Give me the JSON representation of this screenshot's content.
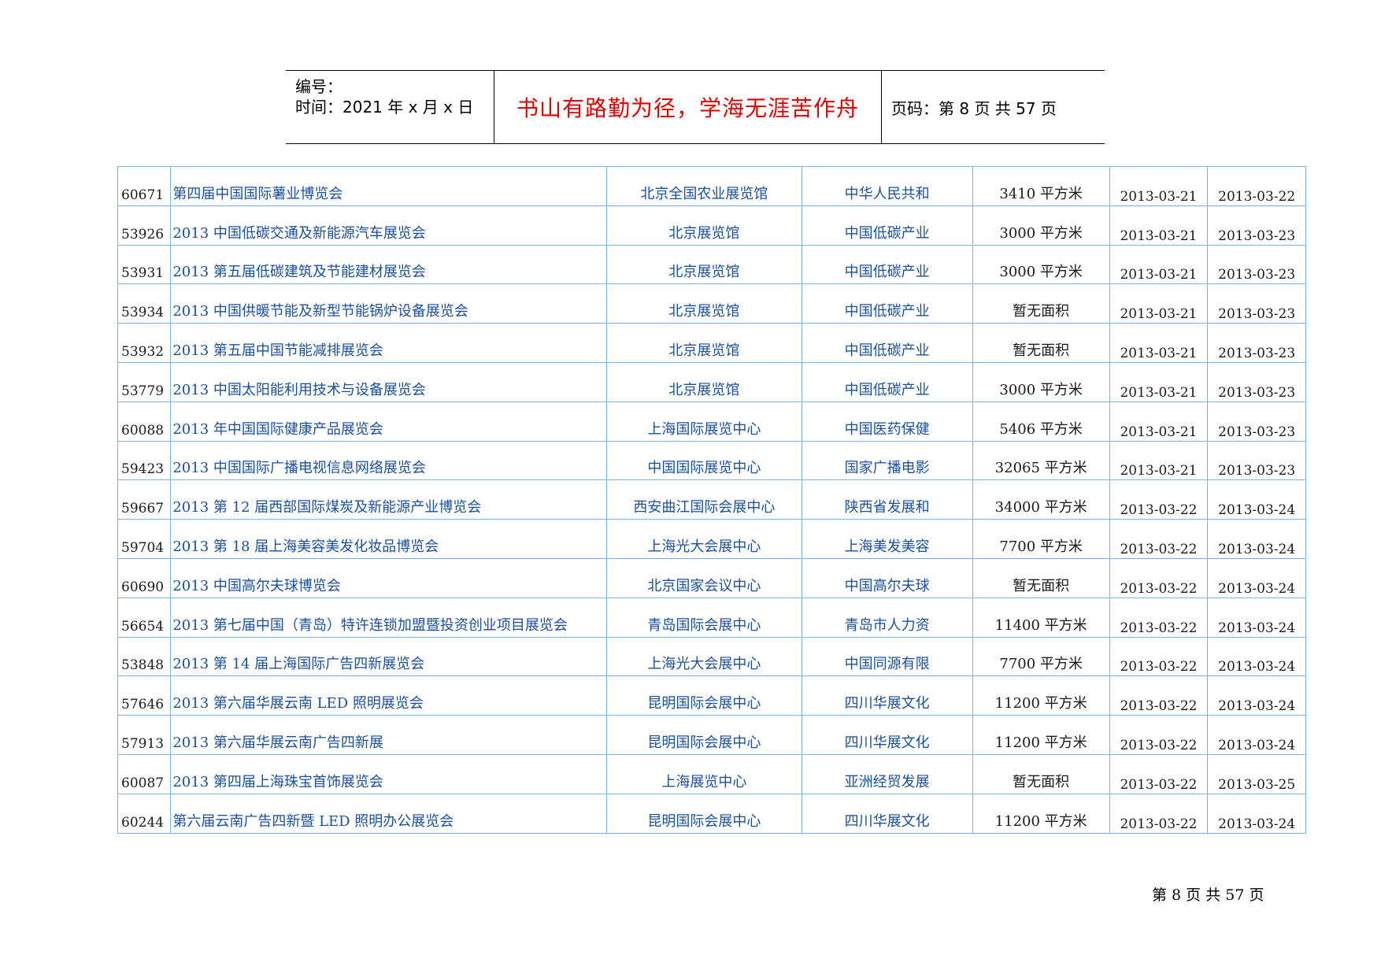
{
  "header": {
    "number_label": "编号：",
    "time_label": "时间：2021 年 x 月 x 日",
    "motto": "书山有路勤为径，学海无涯苦作舟",
    "page_label": "页码：第 8 页  共 57 页"
  },
  "rows": [
    {
      "id": "60671",
      "name": "第四届中国国际薯业博览会",
      "venue": "北京全国农业展览馆",
      "organizer": "中华人民共和",
      "area": "3410 平方米",
      "start": "2013-03-21",
      "end": "2013-03-22"
    },
    {
      "id": "53926",
      "name": "2013 中国低碳交通及新能源汽车展览会",
      "venue": "北京展览馆",
      "organizer": "中国低碳产业",
      "area": "3000 平方米",
      "start": "2013-03-21",
      "end": "2013-03-23"
    },
    {
      "id": "53931",
      "name": "2013 第五届低碳建筑及节能建材展览会",
      "venue": "北京展览馆",
      "organizer": "中国低碳产业",
      "area": "3000 平方米",
      "start": "2013-03-21",
      "end": "2013-03-23"
    },
    {
      "id": "53934",
      "name": "2013 中国供暖节能及新型节能锅炉设备展览会",
      "venue": "北京展览馆",
      "organizer": "中国低碳产业",
      "area": "暂无面积",
      "start": "2013-03-21",
      "end": "2013-03-23"
    },
    {
      "id": "53932",
      "name": "2013 第五届中国节能减排展览会",
      "venue": "北京展览馆",
      "organizer": "中国低碳产业",
      "area": "暂无面积",
      "start": "2013-03-21",
      "end": "2013-03-23"
    },
    {
      "id": "53779",
      "name": "2013 中国太阳能利用技术与设备展览会",
      "venue": "北京展览馆",
      "organizer": "中国低碳产业",
      "area": "3000 平方米",
      "start": "2013-03-21",
      "end": "2013-03-23"
    },
    {
      "id": "60088",
      "name": "2013 年中国国际健康产品展览会",
      "venue": "上海国际展览中心",
      "organizer": "中国医药保健",
      "area": "5406 平方米",
      "start": "2013-03-21",
      "end": "2013-03-23"
    },
    {
      "id": "59423",
      "name": "2013 中国国际广播电视信息网络展览会",
      "venue": "中国国际展览中心",
      "organizer": "国家广播电影",
      "area": "32065 平方米",
      "start": "2013-03-21",
      "end": "2013-03-23"
    },
    {
      "id": "59667",
      "name": "2013 第 12 届西部国际煤炭及新能源产业博览会",
      "venue": "西安曲江国际会展中心",
      "organizer": "陕西省发展和",
      "area": "34000 平方米",
      "start": "2013-03-22",
      "end": "2013-03-24"
    },
    {
      "id": "59704",
      "name": "2013 第 18 届上海美容美发化妆品博览会",
      "venue": "上海光大会展中心",
      "organizer": "上海美发美容",
      "area": "7700 平方米",
      "start": "2013-03-22",
      "end": "2013-03-24"
    },
    {
      "id": "60690",
      "name": "2013 中国高尔夫球博览会",
      "venue": "北京国家会议中心",
      "organizer": "中国高尔夫球",
      "area": "暂无面积",
      "start": "2013-03-22",
      "end": "2013-03-24"
    },
    {
      "id": "56654",
      "name": "2013 第七届中国（青岛）特许连锁加盟暨投资创业项目展览会",
      "venue": "青岛国际会展中心",
      "organizer": "青岛市人力资",
      "area": "11400 平方米",
      "start": "2013-03-22",
      "end": "2013-03-24"
    },
    {
      "id": "53848",
      "name": "2013 第 14 届上海国际广告四新展览会",
      "venue": "上海光大会展中心",
      "organizer": "中国同源有限",
      "area": "7700 平方米",
      "start": "2013-03-22",
      "end": "2013-03-24"
    },
    {
      "id": "57646",
      "name": "2013 第六届华展云南 LED 照明展览会",
      "venue": "昆明国际会展中心",
      "organizer": "四川华展文化",
      "area": "11200 平方米",
      "start": "2013-03-22",
      "end": "2013-03-24"
    },
    {
      "id": "57913",
      "name": "2013 第六届华展云南广告四新展",
      "venue": "昆明国际会展中心",
      "organizer": "四川华展文化",
      "area": "11200 平方米",
      "start": "2013-03-22",
      "end": "2013-03-24"
    },
    {
      "id": "60087",
      "name": "2013 第四届上海珠宝首饰展览会",
      "venue": "上海展览中心",
      "organizer": "亚洲经贸发展",
      "area": "暂无面积",
      "start": "2013-03-22",
      "end": "2013-03-25"
    },
    {
      "id": "60244",
      "name": "第六届云南广告四新暨 LED 照明办公展览会",
      "venue": "昆明国际会展中心",
      "organizer": "四川华展文化",
      "area": "11200 平方米",
      "start": "2013-03-22",
      "end": "2013-03-24"
    }
  ],
  "footer": {
    "page_text": "第 8 页 共 57 页"
  }
}
